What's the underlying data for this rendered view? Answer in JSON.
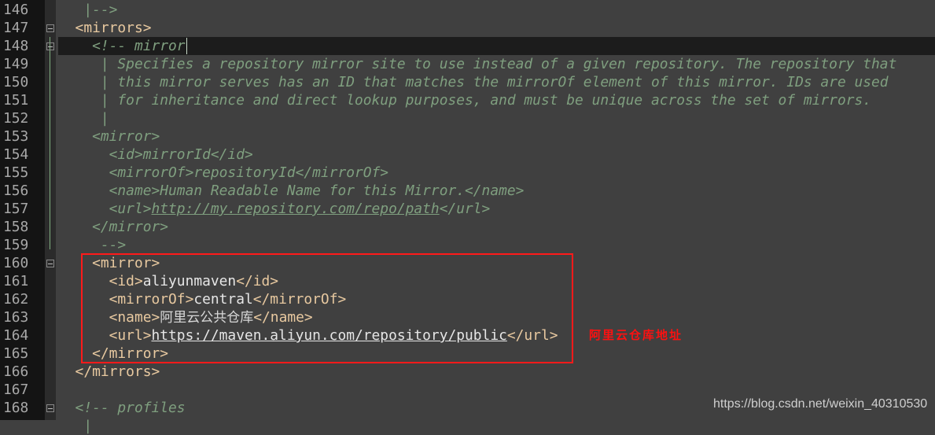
{
  "editor": {
    "lines": [
      {
        "n": "146",
        "segs": [
          {
            "k": "comment",
            "t": "   |-->"
          }
        ]
      },
      {
        "n": "147",
        "fold": true,
        "segs": [
          {
            "k": "tag",
            "t": "  <mirrors>"
          }
        ]
      },
      {
        "n": "148",
        "fold": true,
        "current": true,
        "segs": [
          {
            "k": "comment",
            "t": "    <!-- mirror"
          }
        ]
      },
      {
        "n": "149",
        "segs": [
          {
            "k": "comment",
            "t": "     | Specifies a repository mirror site to use instead of a given repository. The repository that"
          }
        ]
      },
      {
        "n": "150",
        "segs": [
          {
            "k": "comment",
            "t": "     | this mirror serves has an ID that matches the mirrorOf element of this mirror. IDs are used"
          }
        ]
      },
      {
        "n": "151",
        "segs": [
          {
            "k": "comment",
            "t": "     | for inheritance and direct lookup purposes, and must be unique across the set of mirrors."
          }
        ]
      },
      {
        "n": "152",
        "segs": [
          {
            "k": "comment",
            "t": "     |"
          }
        ]
      },
      {
        "n": "153",
        "segs": [
          {
            "k": "comment",
            "t": "    <mirror>"
          }
        ]
      },
      {
        "n": "154",
        "segs": [
          {
            "k": "comment",
            "t": "      <id>mirrorId</id>"
          }
        ]
      },
      {
        "n": "155",
        "segs": [
          {
            "k": "comment",
            "t": "      <mirrorOf>repositoryId</mirrorOf>"
          }
        ]
      },
      {
        "n": "156",
        "segs": [
          {
            "k": "comment",
            "t": "      <name>Human Readable Name for this Mirror.</name>"
          }
        ]
      },
      {
        "n": "157",
        "segs": [
          {
            "k": "comment",
            "t": "      <url>"
          },
          {
            "k": "curl",
            "t": "http://my.repository.com/repo/path"
          },
          {
            "k": "comment",
            "t": "</url>"
          }
        ]
      },
      {
        "n": "158",
        "segs": [
          {
            "k": "comment",
            "t": "    </mirror>"
          }
        ]
      },
      {
        "n": "159",
        "segs": [
          {
            "k": "comment",
            "t": "     -->"
          }
        ]
      },
      {
        "n": "160",
        "fold": true,
        "segs": [
          {
            "k": "tag",
            "t": "    <mirror>"
          }
        ]
      },
      {
        "n": "161",
        "segs": [
          {
            "k": "tag",
            "t": "      <id>"
          },
          {
            "k": "text",
            "t": "aliyunmaven"
          },
          {
            "k": "tag",
            "t": "</id>"
          }
        ]
      },
      {
        "n": "162",
        "segs": [
          {
            "k": "tag",
            "t": "      <mirrorOf>"
          },
          {
            "k": "text",
            "t": "central"
          },
          {
            "k": "tag",
            "t": "</mirrorOf>"
          }
        ]
      },
      {
        "n": "163",
        "segs": [
          {
            "k": "tag",
            "t": "      <name>"
          },
          {
            "k": "cjk",
            "t": "阿里云公共仓库"
          },
          {
            "k": "tag",
            "t": "</name>"
          }
        ]
      },
      {
        "n": "164",
        "segs": [
          {
            "k": "tag",
            "t": "      <url>"
          },
          {
            "k": "url",
            "t": "https://maven.aliyun.com/repository/public"
          },
          {
            "k": "tag",
            "t": "</url>"
          }
        ]
      },
      {
        "n": "165",
        "segs": [
          {
            "k": "tag",
            "t": "    </mirror>"
          }
        ]
      },
      {
        "n": "166",
        "segs": [
          {
            "k": "tag",
            "t": "  </mirrors>"
          }
        ]
      },
      {
        "n": "167",
        "segs": []
      },
      {
        "n": "168",
        "fold": true,
        "segs": [
          {
            "k": "comment",
            "t": "  <!-- profiles"
          }
        ]
      },
      {
        "n": "",
        "segs": [
          {
            "k": "comment",
            "t": "   |"
          }
        ]
      }
    ]
  },
  "annotation": "阿里云仓库地址",
  "watermark": "https://blog.csdn.net/weixin_40310530",
  "colors": {
    "background": "#404040",
    "tag": "#e8c9a0",
    "comment": "#7f9f7f",
    "highlight_box": "#ff1a1a"
  }
}
